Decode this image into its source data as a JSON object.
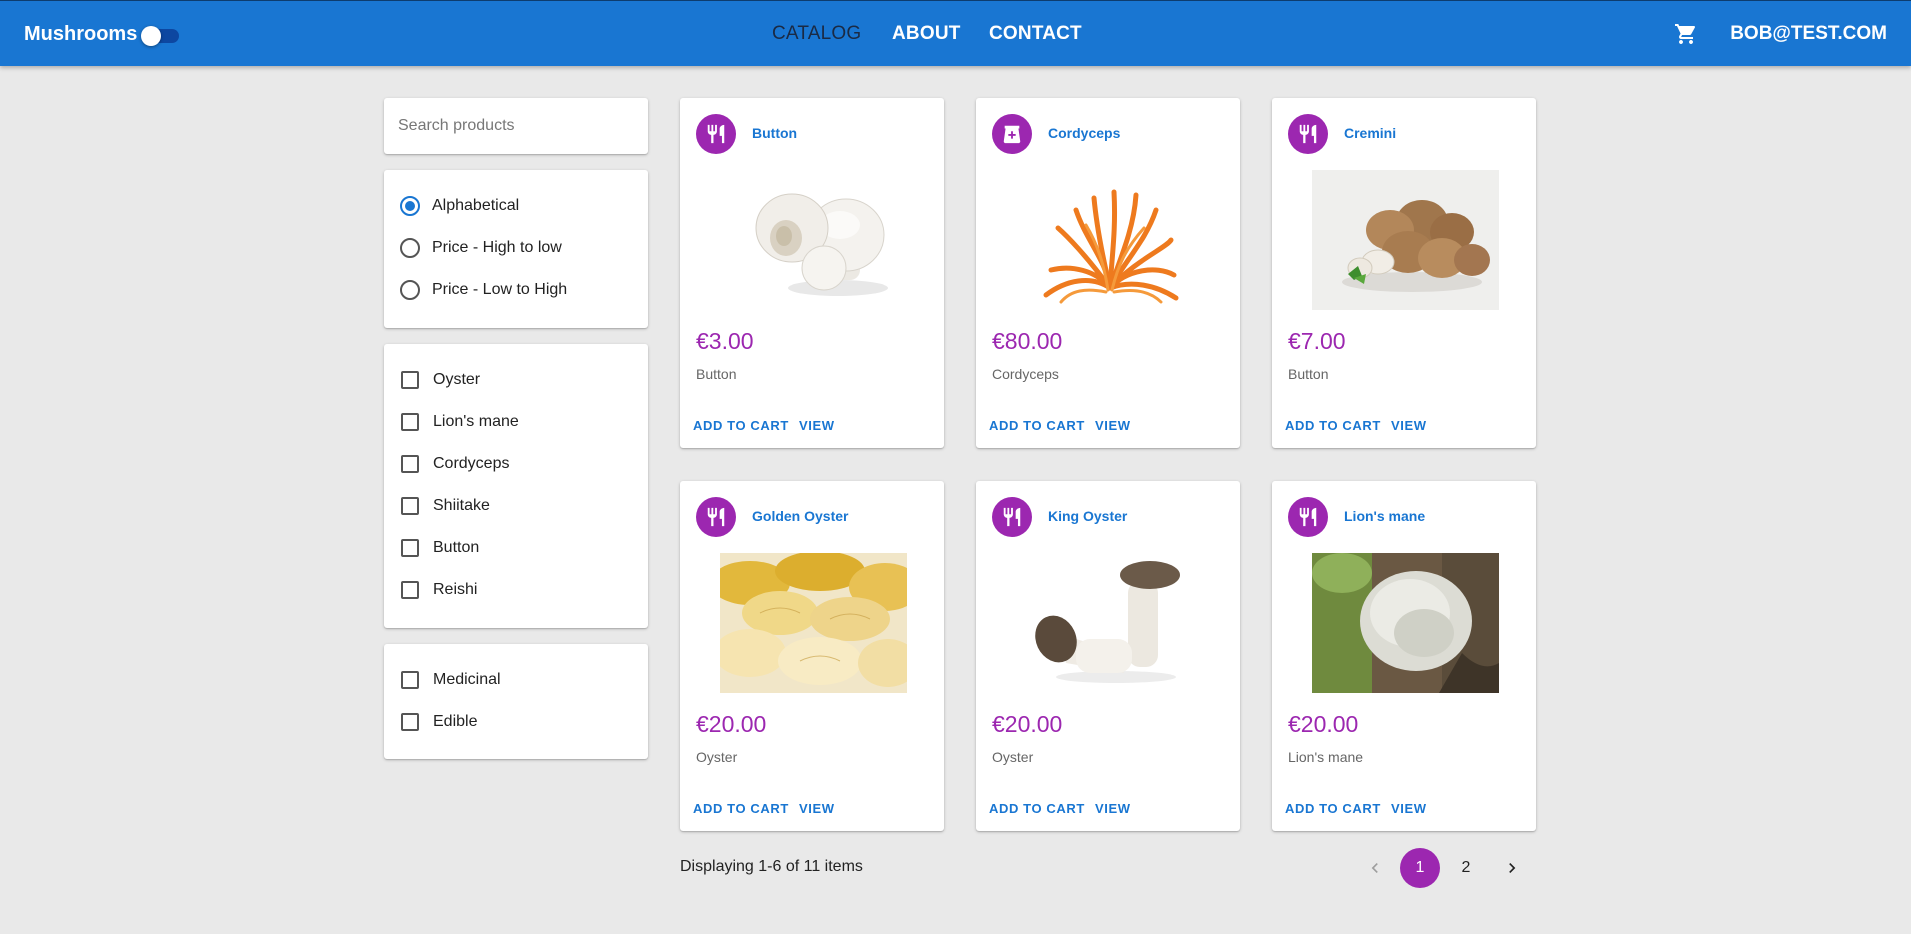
{
  "appbar": {
    "brand": "Mushrooms",
    "nav": [
      "CATALOG",
      "ABOUT",
      "CONTACT"
    ],
    "user": "BOB@TEST.COM",
    "colors": {
      "primary": "#1976d2",
      "accent": "#9c27b0"
    }
  },
  "sidebar": {
    "search_placeholder": "Search products",
    "sort_options": [
      "Alphabetical",
      "Price - High to low",
      "Price - Low to High"
    ],
    "sort_selected": "Alphabetical",
    "species": [
      "Oyster",
      "Lion's mane",
      "Cordyceps",
      "Shiitake",
      "Button",
      "Reishi"
    ],
    "uses": [
      "Medicinal",
      "Edible"
    ]
  },
  "products": [
    {
      "title": "Button",
      "price": "€3.00",
      "type": "Button",
      "icon": "restaurant-icon",
      "image": "white-button-mushrooms"
    },
    {
      "title": "Cordyceps",
      "price": "€80.00",
      "type": "Cordyceps",
      "icon": "medical-kit-icon",
      "image": "orange-cordyceps"
    },
    {
      "title": "Cremini",
      "price": "€7.00",
      "type": "Button",
      "icon": "restaurant-icon",
      "image": "brown-cremini-mushrooms"
    },
    {
      "title": "Golden Oyster",
      "price": "€20.00",
      "type": "Oyster",
      "icon": "restaurant-icon",
      "image": "golden-oyster-cluster"
    },
    {
      "title": "King Oyster",
      "price": "€20.00",
      "type": "Oyster",
      "icon": "restaurant-icon",
      "image": "king-oyster-mushrooms"
    },
    {
      "title": "Lion's mane",
      "price": "€20.00",
      "type": "Lion's mane",
      "icon": "restaurant-icon",
      "image": "lions-mane-on-tree"
    }
  ],
  "card_actions": {
    "add": "ADD TO CART",
    "view": "VIEW"
  },
  "footer": {
    "display_text": "Displaying 1-6 of 11 items",
    "pages": [
      "1",
      "2"
    ],
    "current_page": "1"
  }
}
